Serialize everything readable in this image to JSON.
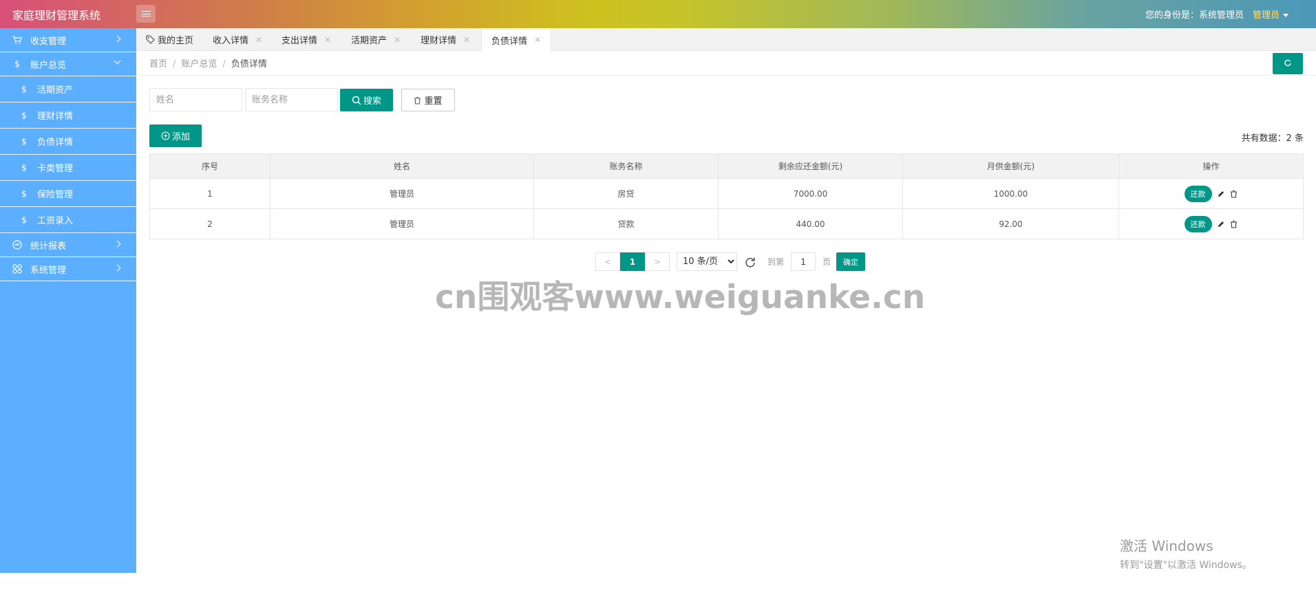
{
  "header": {
    "app_title": "家庭理财管理系统",
    "identity": "您的身份是：系统管理员",
    "user_menu": "管理员"
  },
  "sidebar": {
    "items": [
      {
        "label": "收支管理",
        "icon": "cart-icon"
      },
      {
        "label": "账户总览",
        "icon": "dollar-icon"
      },
      {
        "label": "活期资产",
        "icon": "dollar-icon"
      },
      {
        "label": "理财详情",
        "icon": "dollar-icon"
      },
      {
        "label": "负债详情",
        "icon": "dollar-icon"
      },
      {
        "label": "卡类管理",
        "icon": "dollar-icon"
      },
      {
        "label": "保险管理",
        "icon": "dollar-icon"
      },
      {
        "label": "工资录入",
        "icon": "dollar-icon"
      },
      {
        "label": "统计报表",
        "icon": "chart-icon"
      },
      {
        "label": "系统管理",
        "icon": "grid-icon"
      }
    ]
  },
  "tabs": [
    {
      "label": "我的主页"
    },
    {
      "label": "收入详情"
    },
    {
      "label": "支出详情"
    },
    {
      "label": "活期资产"
    },
    {
      "label": "理财详情"
    },
    {
      "label": "负债详情"
    }
  ],
  "breadcrumb": {
    "home": "首页",
    "section": "账户总览",
    "current": "负债详情"
  },
  "search": {
    "name_placeholder": "姓名",
    "account_placeholder": "账务名称",
    "search_label": "搜索",
    "reset_label": "重置"
  },
  "toolbar": {
    "add_label": "添加",
    "total_label": "共有数据：",
    "total_count": "2",
    "total_unit": " 条"
  },
  "table": {
    "columns": [
      "序号",
      "姓名",
      "账务名称",
      "剩余应还金额(元)",
      "月供金额(元)",
      "操作"
    ],
    "rows": [
      {
        "index": "1",
        "name": "管理员",
        "account": "房贷",
        "remaining": "7000.00",
        "monthly": "1000.00"
      },
      {
        "index": "2",
        "name": "管理员",
        "account": "贷款",
        "remaining": "440.00",
        "monthly": "92.00"
      }
    ],
    "repay_label": "还款"
  },
  "pagination": {
    "prev": "<",
    "current": "1",
    "next": ">",
    "page_size": "10 条/页",
    "goto_label": "到第",
    "goto_value": "1",
    "page_label": "页",
    "confirm_label": "确定"
  },
  "watermark": "cn围观客www.weiguanke.cn",
  "activate_windows": {
    "line1": "激活 Windows",
    "line2": "转到\"设置\"以激活 Windows。"
  },
  "colors": {
    "primary": "#009688",
    "sidebar": "#5caeff",
    "header_gradient_start": "#d94f7a",
    "header_gradient_end": "#4b98b9"
  }
}
